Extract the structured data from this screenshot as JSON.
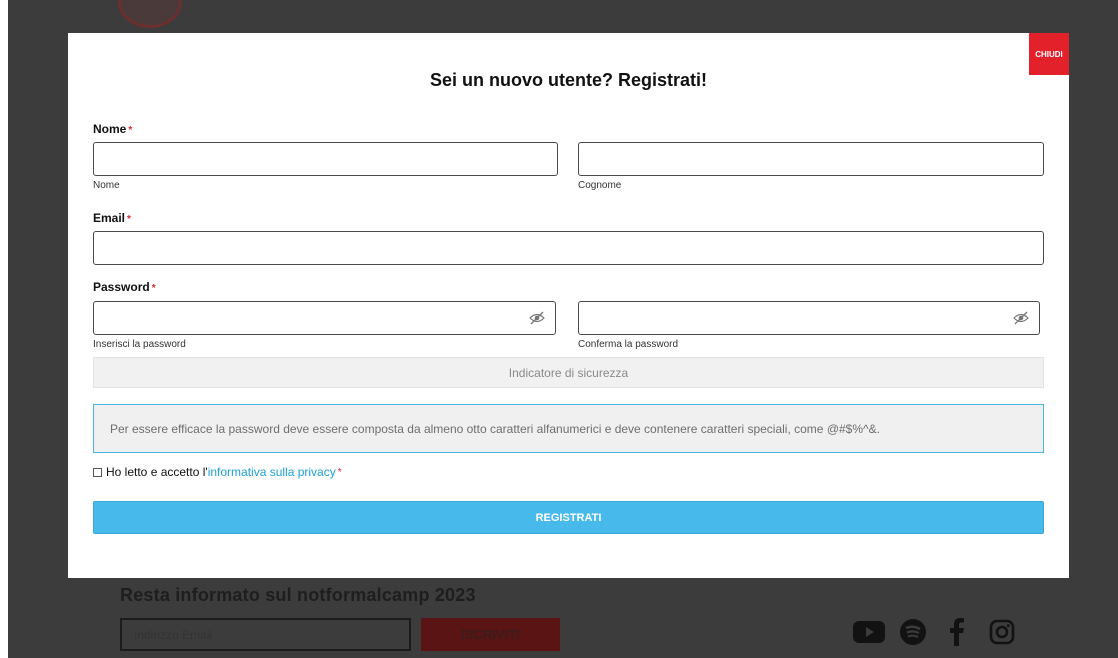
{
  "background": {
    "newsletter_title": "Resta informato sul notformalcamp 2023",
    "email_placeholder": "Indirizzo Email",
    "subscribe_label": "ISCRIVITI",
    "social_icons": [
      "youtube-icon",
      "spotify-icon",
      "facebook-icon",
      "instagram-icon"
    ]
  },
  "modal": {
    "close_label": "CHIUDI",
    "title": "Sei un nuovo utente? Registrati!",
    "name": {
      "label": "Nome",
      "required_mark": "*",
      "first_value": "",
      "first_sublabel": "Nome",
      "last_value": "",
      "last_sublabel": "Cognome"
    },
    "email": {
      "label": "Email",
      "required_mark": "*",
      "value": ""
    },
    "password": {
      "label": "Password",
      "required_mark": "*",
      "value": "",
      "sublabel": "Inserisci la password",
      "confirm_value": "",
      "confirm_sublabel": "Conferma la password"
    },
    "strength_label": "Indicatore di sicurezza",
    "hint": "Per essere efficace la password deve essere composta da almeno otto caratteri alfanumerici e deve contenere caratteri speciali, come @#$%^&.",
    "privacy": {
      "text": "Ho letto e accetto l'",
      "link": "informativa sulla privacy",
      "required_mark": "*",
      "checked": false
    },
    "submit_label": "REGISTRATI"
  },
  "colors": {
    "accent_red": "#e3212a",
    "accent_blue": "#47b9ea",
    "link_blue": "#1ba0d8",
    "overlay": "#3c3c3c"
  }
}
